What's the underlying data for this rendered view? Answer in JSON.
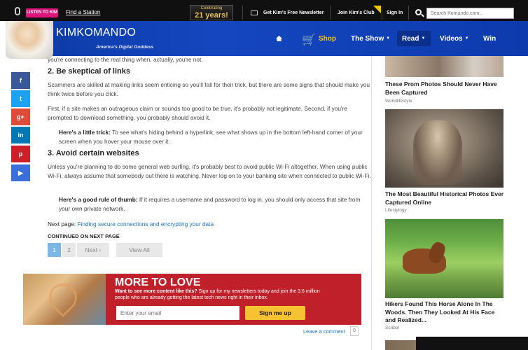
{
  "topbar": {
    "listen_label": "LISTEN TO KIM",
    "find_station": "Find a Station",
    "celebrating_line1": "Celebrating",
    "celebrating_line2": "21 years!",
    "newsletter": "Get Kim's Free Newsletter",
    "club": "Join Kim's Club",
    "sign_in": "Sign In",
    "search_placeholder": "Search Komando.com..."
  },
  "header": {
    "logo_first": "KIM",
    "logo_last": "KOMANDO",
    "tagline": "America's Digital Goddess",
    "nav": {
      "shop": "Shop",
      "show": "The Show",
      "read": "Read",
      "videos": "Videos",
      "win": "Win"
    }
  },
  "share": {
    "facebook": "f",
    "twitter": "t",
    "googleplus": "g+",
    "linkedin": "in",
    "pinterest": "p",
    "more": "▶"
  },
  "article": {
    "intro_tail": "you're connecting to the real thing when, actually, you're not.",
    "section2_title": "2. Be skeptical of links",
    "section2_p1": "Scammers are skilled at making links seem enticing so you'll fall for their trick, but there are some signs that should make you think twice before you click.",
    "section2_p2": "First, if a site makes an outrageous claim or sounds too good to be true, it's probably not legitimate. Second, if you're prompted to download something, you probably should avoid it.",
    "tip1_label": "Here's a little trick:",
    "tip1_text": " To see what's hiding behind a hyperlink, see what shows up in the bottom left-hand corner of your screen when you hover your mouse over it.",
    "section3_title": "3. Avoid certain websites",
    "section3_p1": "Unless you're planning to do some general web surfing, it's probably best to avoid public Wi-Fi altogether. When using public Wi-Fi, always assume that somebody out there is watching. Never log on to your banking site when connected to public Wi-Fi.",
    "tip2_label": "Here's a good rule of thumb:",
    "tip2_text": " If it requires a username and password to log in, you should only access that site from your own private network.",
    "next_page_label": "Next page:",
    "next_page_link": "Finding secure connections and encrypting your data",
    "continued": "CONTINUED ON NEXT PAGE"
  },
  "pager": {
    "page1": "1",
    "page2": "2",
    "next": "Next",
    "view_all": "View All"
  },
  "more_to_love": {
    "title": "MORE TO LOVE",
    "desc_bold": "Want to see more content like this?",
    "desc": " Sign up for my newsletters today and join the 3.6 million people who are already getting the latest tech news right in their inbox.",
    "email_placeholder": "Enter your email",
    "signup": "Sign me up"
  },
  "comments": {
    "leave": "Leave a comment",
    "count": "0"
  },
  "sidebar": {
    "items": [
      {
        "title": "These Prom Photos Should Never Have Been Captured",
        "source": "Worldlifestyle"
      },
      {
        "title": "The Most Beautiful Historical Photos Ever Captured Online",
        "source": "Lifestylogy"
      },
      {
        "title": "Hikers Found This Horse Alone In The Woods. Then They Looked At His Face and Realized...",
        "source": "Scribol"
      }
    ]
  },
  "colors": {
    "header_blue": "#1446c0",
    "shop_yellow": "#f6c700",
    "listen_pink": "#e0147d",
    "banner_red": "#c0202a",
    "link_blue": "#1e73be"
  }
}
